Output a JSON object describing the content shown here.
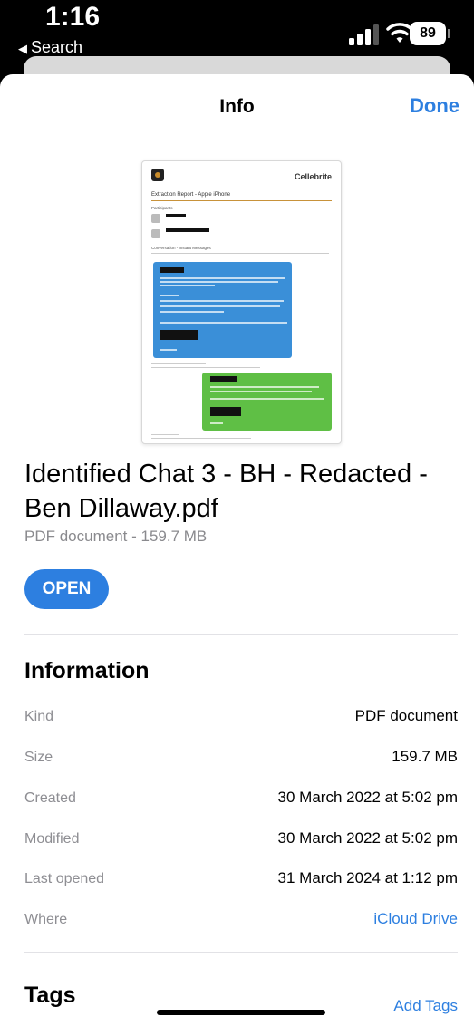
{
  "status_bar": {
    "time": "1:16",
    "back_label": "Search",
    "battery": "89"
  },
  "nav": {
    "title": "Info",
    "done_label": "Done"
  },
  "preview": {
    "brand": "Cellebrite",
    "report_title": "Extraction Report - Apple iPhone",
    "participants_label": "Participants",
    "conversation_label": "Conversation - Instant Messages"
  },
  "file": {
    "name": "Identified Chat 3 - BH - Redacted - Ben Dillaway.pdf",
    "subtitle": "PDF document - 159.7 MB",
    "open_label": "OPEN"
  },
  "information": {
    "title": "Information",
    "rows": [
      {
        "label": "Kind",
        "value": "PDF document"
      },
      {
        "label": "Size",
        "value": "159.7 MB"
      },
      {
        "label": "Created",
        "value": "30 March 2022 at 5:02 pm"
      },
      {
        "label": "Modified",
        "value": "30 March 2022 at 5:02 pm"
      },
      {
        "label": "Last opened",
        "value": "31 March 2024 at 1:12 pm"
      },
      {
        "label": "Where",
        "value": "iCloud Drive"
      }
    ]
  },
  "tags": {
    "title": "Tags",
    "add_label": "Add Tags"
  },
  "colors": {
    "accent": "#2d7fe0",
    "blue_bubble": "#3a8fd8",
    "green_bubble": "#5fbf45"
  }
}
